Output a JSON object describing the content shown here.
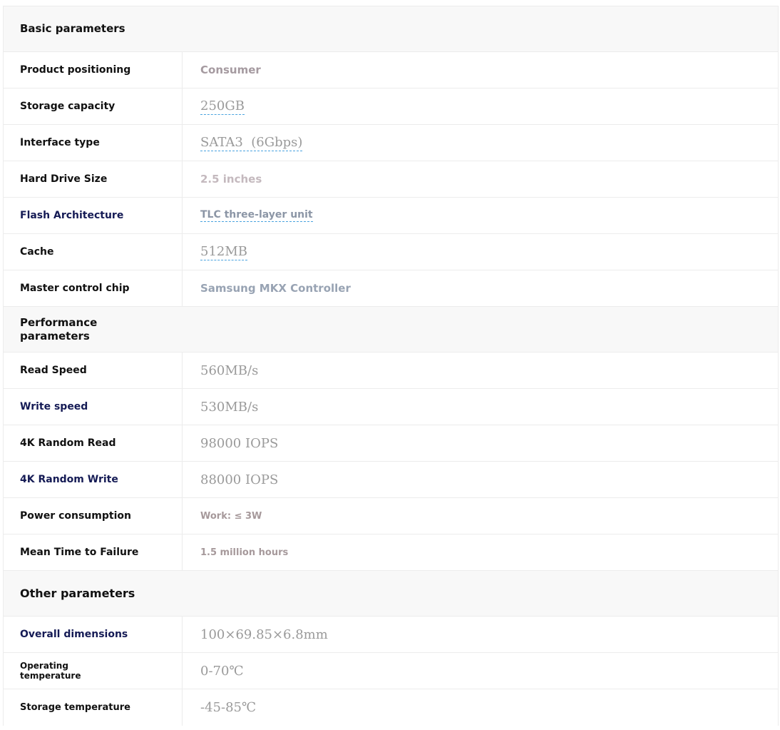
{
  "sections": {
    "basic": {
      "title": "Basic parameters",
      "rows": [
        {
          "label": "Product positioning",
          "value": "Consumer"
        },
        {
          "label": "Storage capacity",
          "value": "250GB"
        },
        {
          "label": "Interface type",
          "value": "SATA3  (6Gbps)"
        },
        {
          "label": "Hard Drive Size",
          "value": "2.5 inches"
        },
        {
          "label": "Flash Architecture",
          "value": "TLC three-layer unit"
        },
        {
          "label": "Cache",
          "value": "512MB"
        },
        {
          "label": "Master control chip",
          "value": "Samsung MKX Controller"
        }
      ]
    },
    "performance": {
      "title": "Performance parameters",
      "rows": [
        {
          "label": "Read Speed",
          "value": "560MB/s"
        },
        {
          "label": "Write speed",
          "value": "530MB/s"
        },
        {
          "label": "4K Random Read",
          "value": "98000 IOPS"
        },
        {
          "label": "4K Random Write",
          "value": "88000 IOPS"
        },
        {
          "label": "Power consumption",
          "value": "Work: ≤ 3W"
        },
        {
          "label": "Mean Time to Failure",
          "value": "1.5 million hours"
        }
      ]
    },
    "other": {
      "title": "Other parameters",
      "rows": [
        {
          "label": "Overall dimensions",
          "value": "100×69.85×6.8mm"
        },
        {
          "label": "Operating temperature",
          "value": "0-70℃"
        },
        {
          "label": "Storage temperature",
          "value": "-45-85℃"
        }
      ]
    }
  }
}
